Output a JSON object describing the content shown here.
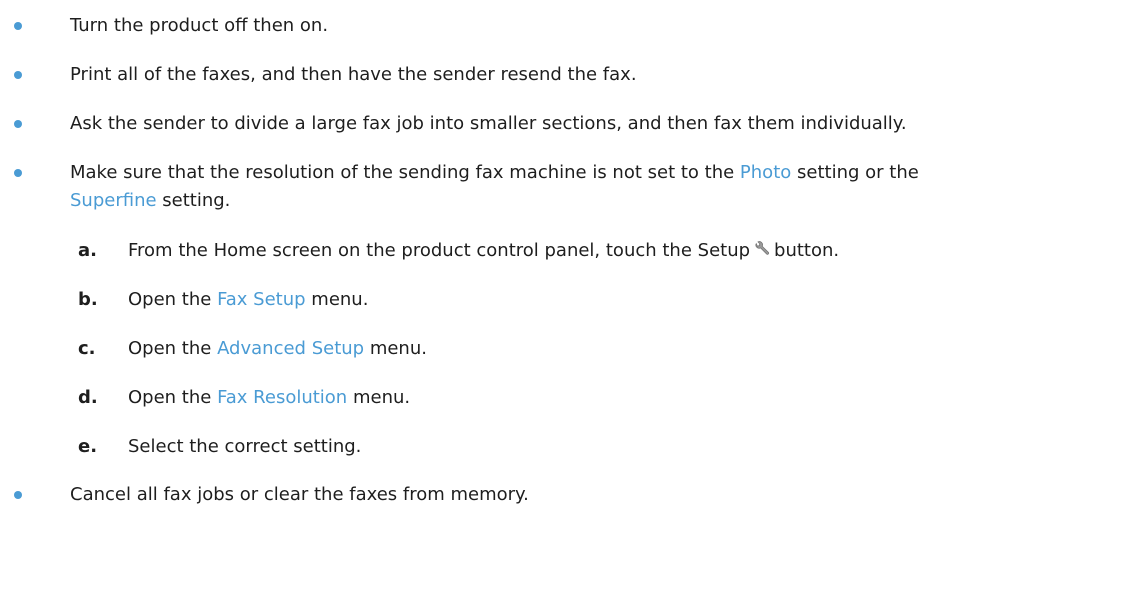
{
  "bullets": [
    {
      "text": "Turn the product off then on."
    },
    {
      "text": "Print all of the faxes, and then have the sender resend the fax."
    },
    {
      "text": "Ask the sender to divide a large fax job into smaller sections, and then fax them individually."
    },
    {
      "line1_pre": "Make sure that the resolution of the sending fax machine is not set to the ",
      "link1": "Photo",
      "line1_mid": " setting or the",
      "link2": "Superfine",
      "line2_post": " setting."
    },
    {
      "text": "Cancel all fax jobs or clear the faxes from memory."
    }
  ],
  "steps": [
    {
      "letter": "a.",
      "pre": "From the Home screen on the product control panel, touch the Setup",
      "icon": "wrench-icon",
      "post": "button."
    },
    {
      "letter": "b.",
      "pre": "Open the ",
      "link": "Fax Setup",
      "post": " menu."
    },
    {
      "letter": "c.",
      "pre": "Open the ",
      "link": "Advanced Setup",
      "post": " menu."
    },
    {
      "letter": "d.",
      "pre": "Open the ",
      "link": "Fax Resolution",
      "post": " menu."
    },
    {
      "letter": "e.",
      "text": "Select the correct setting."
    }
  ],
  "colors": {
    "bullet": "#4a9bd4",
    "link": "#4a9bd4",
    "text": "#1e1e1e"
  }
}
